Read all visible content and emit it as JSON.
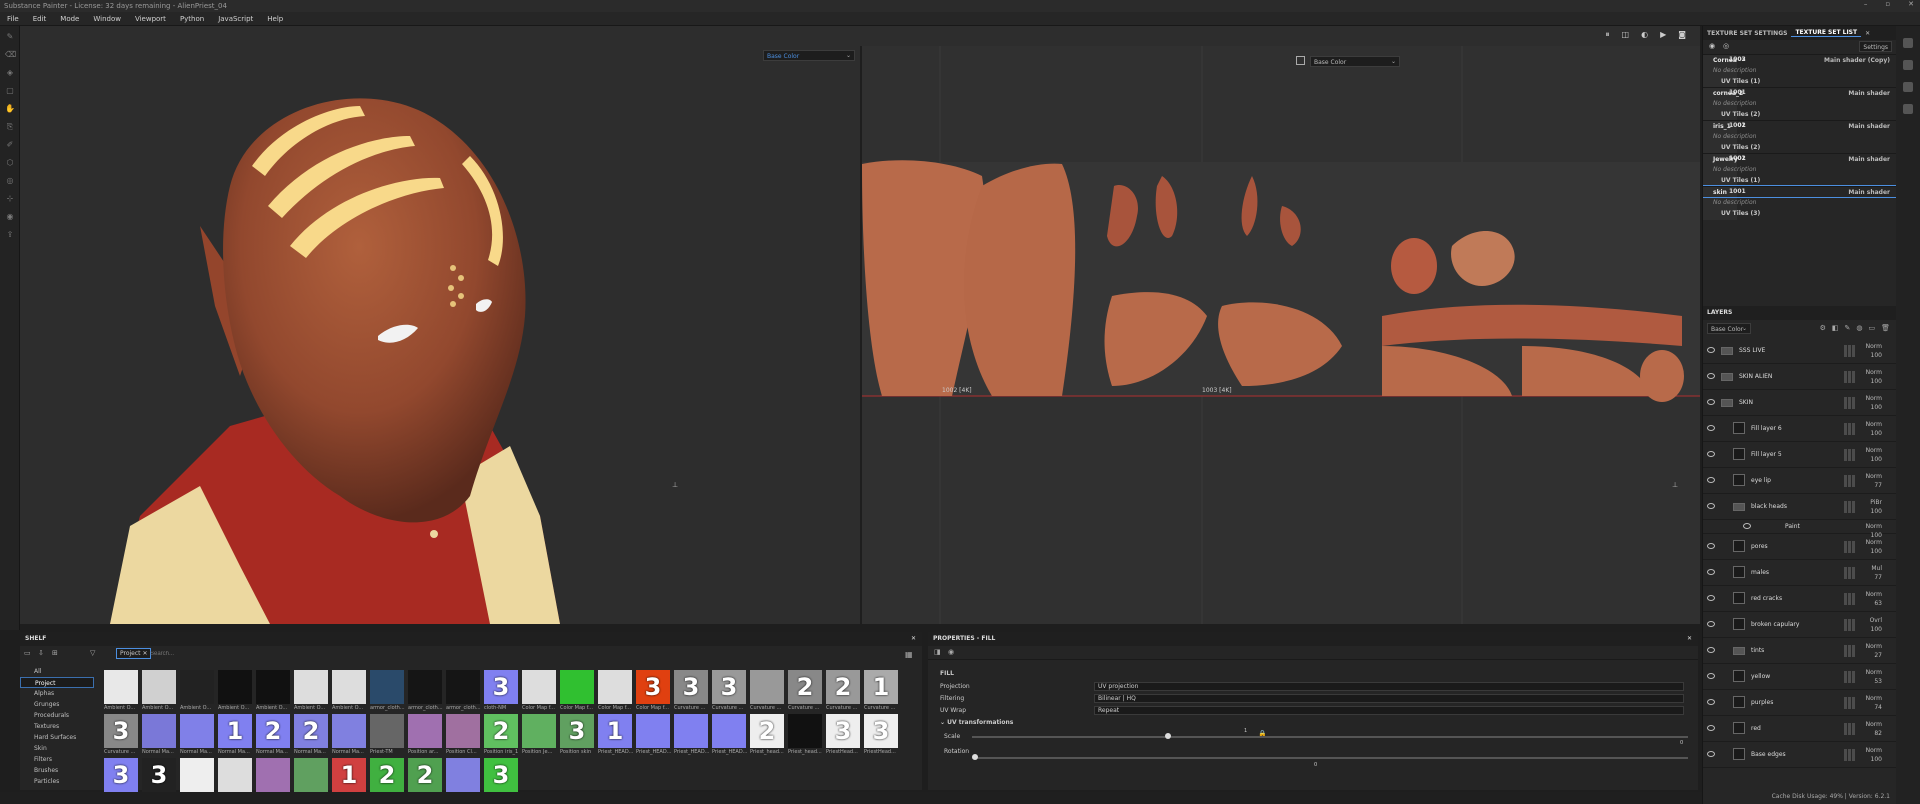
{
  "titlebar": {
    "text": "Substance Painter - License: 32 days remaining - AlienPriest_04"
  },
  "menu": [
    "File",
    "Edit",
    "Mode",
    "Window",
    "Viewport",
    "Python",
    "JavaScript",
    "Help"
  ],
  "viewport": {
    "channel_3d": "Base Color",
    "channel_2d": "Base Color",
    "uv_labels": [
      "1002  [4K]",
      "1003  [4K]"
    ]
  },
  "texture_sets": {
    "tabs": [
      "TEXTURE SET SETTINGS",
      "TEXTURE SET LIST"
    ],
    "settings_label": "Settings",
    "rows": [
      {
        "type": "tile",
        "text": "1002"
      },
      {
        "type": "tile",
        "text": "1003"
      },
      {
        "type": "name",
        "text": "Cornea",
        "right": "Main shader (Copy)"
      },
      {
        "type": "desc",
        "text": "No description"
      },
      {
        "type": "uvt",
        "text": "UV Tiles (1)"
      },
      {
        "type": "tile",
        "text": "1001"
      },
      {
        "type": "name",
        "text": "cornea_2",
        "right": "Main shader"
      },
      {
        "type": "desc",
        "text": "No description"
      },
      {
        "type": "uvt",
        "text": "UV Tiles (2)"
      },
      {
        "type": "tile",
        "text": "1001"
      },
      {
        "type": "tile",
        "text": "1002"
      },
      {
        "type": "name",
        "text": "iris_1",
        "right": "Main shader"
      },
      {
        "type": "desc",
        "text": "No description"
      },
      {
        "type": "uvt",
        "text": "UV Tiles (2)"
      },
      {
        "type": "tile",
        "text": "1001"
      },
      {
        "type": "tile",
        "text": "1002"
      },
      {
        "type": "name",
        "text": "Jewelry",
        "right": "Main shader"
      },
      {
        "type": "desc",
        "text": "No description"
      },
      {
        "type": "uvt",
        "text": "UV Tiles (1)"
      },
      {
        "type": "tile",
        "text": "1001"
      },
      {
        "type": "name sel",
        "text": "skin",
        "right": "Main shader"
      },
      {
        "type": "desc",
        "text": "No description"
      },
      {
        "type": "uvt",
        "text": "UV Tiles (3)"
      }
    ]
  },
  "layers": {
    "header": "LAYERS",
    "channel": "Base Color",
    "items": [
      {
        "name": "SSS LIVE",
        "kind": "folder",
        "indent": 0,
        "blend": "Norm",
        "opacity": "100"
      },
      {
        "name": "SKIN ALIEN",
        "kind": "folder",
        "indent": 0,
        "blend": "Norm",
        "opacity": "100"
      },
      {
        "name": "SKIN",
        "kind": "folder",
        "indent": 0,
        "blend": "Norm",
        "opacity": "100"
      },
      {
        "name": "Fill layer 6",
        "kind": "fill",
        "indent": 1,
        "blend": "Norm",
        "opacity": "100"
      },
      {
        "name": "Fill layer 5",
        "kind": "fill",
        "indent": 1,
        "blend": "Norm",
        "opacity": "100"
      },
      {
        "name": "eye lip",
        "kind": "fill",
        "indent": 1,
        "blend": "Norm",
        "opacity": "77"
      },
      {
        "name": "black heads",
        "kind": "folder",
        "indent": 1,
        "blend": "PiBr",
        "opacity": "100"
      },
      {
        "name": "Paint",
        "kind": "paint",
        "indent": 2,
        "blend": "Norm",
        "opacity": "100"
      },
      {
        "name": "pores",
        "kind": "fill",
        "indent": 1,
        "blend": "Norm",
        "opacity": "100"
      },
      {
        "name": "males",
        "kind": "fill",
        "indent": 1,
        "blend": "Mul",
        "opacity": "77"
      },
      {
        "name": "red cracks",
        "kind": "fill",
        "indent": 1,
        "blend": "Norm",
        "opacity": "63"
      },
      {
        "name": "broken capulary",
        "kind": "fill",
        "indent": 1,
        "blend": "Ovrl",
        "opacity": "100"
      },
      {
        "name": "tints",
        "kind": "folder",
        "indent": 1,
        "blend": "Norm",
        "opacity": "27"
      },
      {
        "name": "yellow",
        "kind": "fill",
        "indent": 1,
        "blend": "Norm",
        "opacity": "53"
      },
      {
        "name": "purples",
        "kind": "fill",
        "indent": 1,
        "blend": "Norm",
        "opacity": "74"
      },
      {
        "name": "red",
        "kind": "fill",
        "indent": 1,
        "blend": "Norm",
        "opacity": "82"
      },
      {
        "name": "Base edges",
        "kind": "fill",
        "indent": 1,
        "blend": "Norm",
        "opacity": "100"
      }
    ]
  },
  "shelf": {
    "header": "SHELF",
    "filter_tag": "Project",
    "search_placeholder": "Search...",
    "categories": [
      "All",
      "Project",
      "Alphas",
      "Grunges",
      "Procedurals",
      "Textures",
      "Hard Surfaces",
      "Skin",
      "Filters",
      "Brushes",
      "Particles"
    ],
    "selected_category": "Project",
    "items": [
      {
        "label": "Ambient O...",
        "glyph": "",
        "color": "#e8e8e8"
      },
      {
        "label": "Ambient O...",
        "glyph": "",
        "color": "#d0d0d0"
      },
      {
        "label": "Ambient O...",
        "glyph": "",
        "color": "#222"
      },
      {
        "label": "Ambient O...",
        "glyph": "",
        "color": "#111"
      },
      {
        "label": "Ambient O...",
        "glyph": "",
        "color": "#111"
      },
      {
        "label": "Ambient O...",
        "glyph": "",
        "color": "#ddd"
      },
      {
        "label": "Ambient O...",
        "glyph": "",
        "color": "#ddd"
      },
      {
        "label": "armor_cloth...",
        "glyph": "",
        "color": "#2a4a6a"
      },
      {
        "label": "armor_cloth...",
        "glyph": "",
        "color": "#151515"
      },
      {
        "label": "armor_cloth...",
        "glyph": "",
        "color": "#151515"
      },
      {
        "label": "cloth-NM",
        "glyph": "3",
        "color": "#8080f0"
      },
      {
        "label": "Color Map f...",
        "glyph": "",
        "color": "#ddd"
      },
      {
        "label": "Color Map f...",
        "glyph": "",
        "color": "#30c030"
      },
      {
        "label": "Color Map f...",
        "glyph": "",
        "color": "#ddd"
      },
      {
        "label": "Color Map f...",
        "glyph": "3",
        "color": "#e04010"
      },
      {
        "label": "Curvature ...",
        "glyph": "3",
        "color": "#888"
      },
      {
        "label": "Curvature ...",
        "glyph": "3",
        "color": "#999"
      },
      {
        "label": "Curvature ...",
        "glyph": "",
        "color": "#999"
      },
      {
        "label": "Curvature ...",
        "glyph": "2",
        "color": "#888"
      },
      {
        "label": "Curvature ...",
        "glyph": "2",
        "color": "#999"
      },
      {
        "label": "Curvature ...",
        "glyph": "1",
        "color": "#aaa"
      },
      {
        "label": "Curvature ...",
        "glyph": "3",
        "color": "#888"
      },
      {
        "label": "Normal Ma...",
        "glyph": "",
        "color": "#7a78d8"
      },
      {
        "label": "Normal Ma...",
        "glyph": "",
        "color": "#8080e8"
      },
      {
        "label": "Normal Ma...",
        "glyph": "1",
        "color": "#8080f0"
      },
      {
        "label": "Normal Ma...",
        "glyph": "2",
        "color": "#8080f0"
      },
      {
        "label": "Normal Ma...",
        "glyph": "2",
        "color": "#8080e0"
      },
      {
        "label": "Normal Ma...",
        "glyph": "",
        "color": "#8080e0"
      },
      {
        "label": "Priest-TM",
        "glyph": "",
        "color": "#666"
      },
      {
        "label": "Position ar...",
        "glyph": "",
        "color": "#a070b0"
      },
      {
        "label": "Position Cl...",
        "glyph": "",
        "color": "#a070a0"
      },
      {
        "label": "Position iris_1",
        "glyph": "2",
        "color": "#60c060"
      },
      {
        "label": "Position Je...",
        "glyph": "",
        "color": "#60b060"
      },
      {
        "label": "Position skin",
        "glyph": "3",
        "color": "#60a060"
      },
      {
        "label": "Priest_HEAD...",
        "glyph": "1",
        "color": "#8080f0"
      },
      {
        "label": "Priest_HEAD...",
        "glyph": "",
        "color": "#8080f0"
      },
      {
        "label": "Priest_HEAD...",
        "glyph": "",
        "color": "#8080f0"
      },
      {
        "label": "Priest_HEAD...",
        "glyph": "",
        "color": "#8080f0"
      },
      {
        "label": "Priest_head...",
        "glyph": "2",
        "color": "#eee"
      },
      {
        "label": "Priest_head...",
        "glyph": "",
        "color": "#111"
      },
      {
        "label": "PriestHead...",
        "glyph": "3",
        "color": "#eee"
      },
      {
        "label": "PriestHead...",
        "glyph": "3",
        "color": "#eee"
      },
      {
        "label": "",
        "glyph": "3",
        "color": "#8080f0"
      },
      {
        "label": "",
        "glyph": "3",
        "color": "#222"
      },
      {
        "label": "",
        "glyph": "",
        "color": "#eee"
      },
      {
        "label": "",
        "glyph": "",
        "color": "#ddd"
      },
      {
        "label": "",
        "glyph": "",
        "color": "#a070b0"
      },
      {
        "label": "",
        "glyph": "",
        "color": "#60a060"
      },
      {
        "label": "",
        "glyph": "1",
        "color": "#d04040"
      },
      {
        "label": "",
        "glyph": "2",
        "color": "#40b040"
      },
      {
        "label": "",
        "glyph": "2",
        "color": "#50a050"
      },
      {
        "label": "",
        "glyph": "",
        "color": "#8080e0"
      },
      {
        "label": "",
        "glyph": "3",
        "color": "#40c040"
      }
    ]
  },
  "properties": {
    "header": "PROPERTIES - FILL",
    "section": "FILL",
    "rows": [
      {
        "label": "Projection",
        "value": "UV projection"
      },
      {
        "label": "Filtering",
        "value": "Bilinear | HQ"
      },
      {
        "label": "UV Wrap",
        "value": "Repeat"
      }
    ],
    "uvt_header": "UV transformations",
    "scale_label": "Scale",
    "scale_value": "1",
    "rotation_label": "Rotation",
    "rotation_value": "0",
    "slider_max": "0"
  },
  "status": {
    "text": "Cache Disk Usage:    49% | Version: 6.2.1"
  }
}
